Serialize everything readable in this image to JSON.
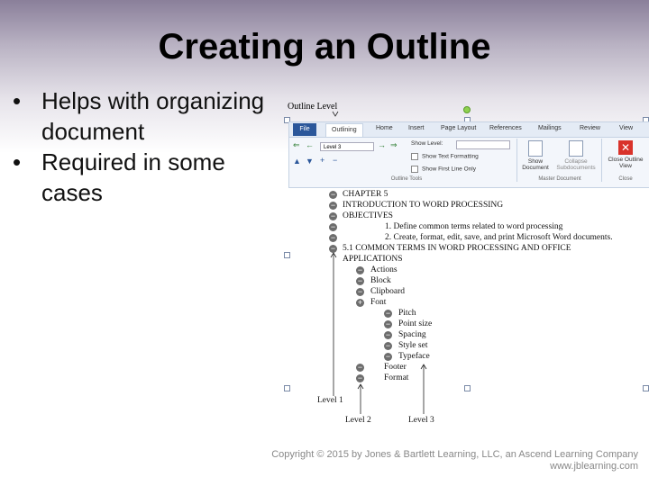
{
  "slide": {
    "title": "Creating an Outline",
    "bullets": [
      "Helps with organizing document",
      "Required in some cases"
    ],
    "copyright_line1": "Copyright © 2015 by Jones & Bartlett Learning, LLC, an Ascend Learning Company",
    "copyright_line2": "www.jblearning.com"
  },
  "figure": {
    "outline_level_label": "Outline Level",
    "level_labels": [
      "Level 1",
      "Level 2",
      "Level 3"
    ]
  },
  "ribbon": {
    "tabs": [
      "File",
      "Outlining",
      "Home",
      "Insert",
      "Page Layout",
      "References",
      "Mailings",
      "Review",
      "View"
    ],
    "level_select": "Level 3",
    "show_level": "Show Level:",
    "show_text_formatting": "Show Text Formatting",
    "show_first_line_only": "Show First Line Only",
    "show_document": "Show Document",
    "collapse_subdocuments": "Collapse Subdocuments",
    "close_outline_view": "Close Outline View",
    "group_outline_tools": "Outline Tools",
    "group_master_document": "Master Document",
    "group_close": "Close"
  },
  "outline": [
    {
      "text": "CHAPTER 5",
      "symbol": "minus"
    },
    {
      "text": "INTRODUCTION TO WORD PROCESSING",
      "symbol": "minus"
    },
    {
      "text": "OBJECTIVES",
      "symbol": "minus"
    },
    {
      "text": "1. Define common terms related to word processing",
      "symbol": "minus"
    },
    {
      "text": "2. Create, format, edit, save, and print Microsoft Word documents.",
      "symbol": "minus"
    },
    {
      "text": "5.1 COMMON TERMS IN WORD PROCESSING AND OFFICE",
      "symbol": "minus"
    },
    {
      "text": "APPLICATIONS",
      "symbol": "none"
    },
    {
      "text": "Actions",
      "symbol": "minus"
    },
    {
      "text": "Block",
      "symbol": "minus"
    },
    {
      "text": "Clipboard",
      "symbol": "minus"
    },
    {
      "text": "Font",
      "symbol": "plus"
    },
    {
      "text": "Pitch",
      "symbol": "minus"
    },
    {
      "text": "Point size",
      "symbol": "minus"
    },
    {
      "text": "Spacing",
      "symbol": "minus"
    },
    {
      "text": "Style set",
      "symbol": "minus"
    },
    {
      "text": "Typeface",
      "symbol": "minus"
    },
    {
      "text": "Footer",
      "symbol": "minus"
    },
    {
      "text": "Format",
      "symbol": "minus"
    }
  ],
  "colors": {
    "file_tab": "#2b579a",
    "close_button": "#d9332b"
  }
}
